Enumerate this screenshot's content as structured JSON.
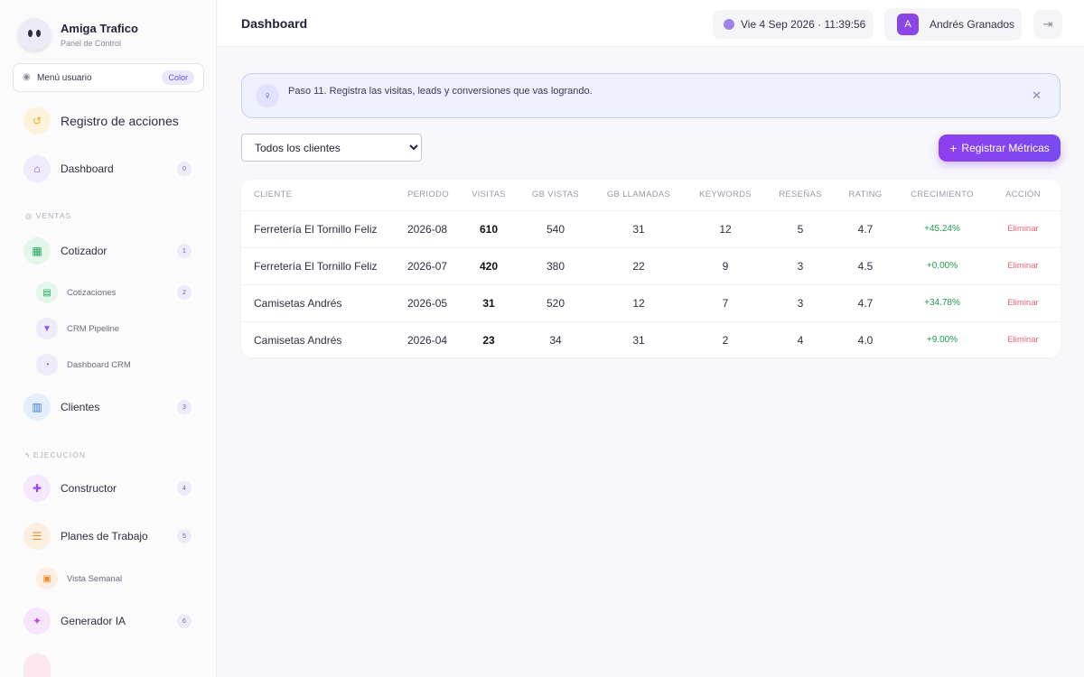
{
  "brand": {
    "name": "Amiga Trafico",
    "subtitle": "Panel de Control"
  },
  "user_menu": {
    "label": "Menú usuario",
    "pill": "Color"
  },
  "sidebar": {
    "items": [
      {
        "label": "Registro de acciones",
        "icon": "history-icon",
        "color": "#f5a524",
        "bg": "#fdf3dc"
      },
      {
        "label": "Dashboard",
        "badge": "0",
        "icon": "home-icon",
        "color": "#7b5ae6",
        "bg": "#efeafc"
      },
      {
        "label": "Cotizador",
        "badge": "1",
        "icon": "calculator-icon",
        "color": "#1fa85a",
        "bg": "#e3f6ea"
      },
      {
        "label": "Cotizaciones",
        "badge": "2",
        "icon": "document-icon",
        "color": "#1fa85a",
        "bg": "#e3f6ea"
      },
      {
        "label": "CRM Pipeline",
        "icon": "funnel-icon",
        "color": "#8a5ce6",
        "bg": "#efeafc"
      },
      {
        "label": "Dashboard CRM",
        "icon": "pie-chart-icon",
        "color": "#8a5ce6",
        "bg": "#efeafc"
      },
      {
        "label": "Clientes",
        "badge": "3",
        "icon": "building-icon",
        "color": "#3a7be8",
        "bg": "#e4eefc"
      },
      {
        "label": "Constructor",
        "badge": "4",
        "icon": "puzzle-icon",
        "color": "#9b45e6",
        "bg": "#f3e8fc"
      },
      {
        "label": "Planes de Trabajo",
        "badge": "5",
        "icon": "list-check-icon",
        "color": "#f08a24",
        "bg": "#fdefe0"
      },
      {
        "label": "Vista Semanal",
        "icon": "calendar-icon",
        "color": "#f08a24",
        "bg": "#fdefe0"
      },
      {
        "label": "Generador IA",
        "badge": "6",
        "icon": "magic-wand-icon",
        "color": "#c04ad8",
        "bg": "#f7e6fb"
      }
    ],
    "sections": {
      "ventas": "VENTAS",
      "ejecucion": "EJECUCIÓN"
    }
  },
  "header": {
    "title": "Dashboard",
    "datetime": "Vie 4 Sep 2026 · 11:39:56",
    "user_initial": "A",
    "user_name": "Andrés Granados"
  },
  "tip": {
    "text": "Paso 11. Registra las visitas, leads y conversiones que vas logrando."
  },
  "filter": {
    "selected": "Todos los clientes"
  },
  "actions": {
    "register_label": "Registrar Métricas"
  },
  "table": {
    "headers": [
      "CLIENTE",
      "PERIODO",
      "VISITAS",
      "GB VISTAS",
      "GB LLAMADAS",
      "KEYWORDS",
      "RESEÑAS",
      "RATING",
      "CRECIMIENTO",
      "ACCIÓN"
    ],
    "rows": [
      {
        "cliente": "Ferretería El Tornillo Feliz",
        "periodo": "2026-08",
        "visitas": "610",
        "gb_vistas": "540",
        "gb_llamadas": "31",
        "keywords": "12",
        "resenas": "5",
        "rating": "4.7",
        "crecimiento": "+45.24%",
        "accion": "Eliminar"
      },
      {
        "cliente": "Ferretería El Tornillo Feliz",
        "periodo": "2026-07",
        "visitas": "420",
        "gb_vistas": "380",
        "gb_llamadas": "22",
        "keywords": "9",
        "resenas": "3",
        "rating": "4.5",
        "crecimiento": "+0.00%",
        "accion": "Eliminar"
      },
      {
        "cliente": "Camisetas Andrés",
        "periodo": "2026-05",
        "visitas": "31",
        "gb_vistas": "520",
        "gb_llamadas": "12",
        "keywords": "7",
        "resenas": "3",
        "rating": "4.7",
        "crecimiento": "+34.78%",
        "accion": "Eliminar"
      },
      {
        "cliente": "Camisetas Andrés",
        "periodo": "2026-04",
        "visitas": "23",
        "gb_vistas": "34",
        "gb_llamadas": "31",
        "keywords": "2",
        "resenas": "4",
        "rating": "4.0",
        "crecimiento": "+9.00%",
        "accion": "Eliminar"
      }
    ]
  }
}
